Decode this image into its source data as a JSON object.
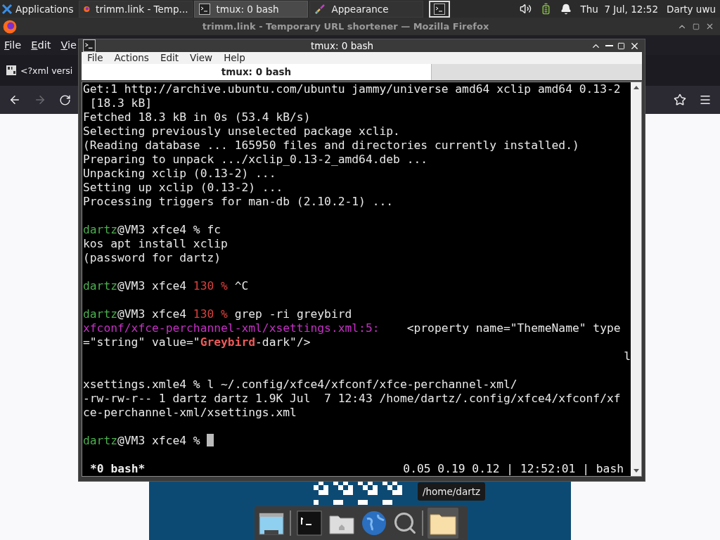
{
  "top_panel": {
    "applications": "Applications",
    "tasks": [
      {
        "kind": "firefox",
        "label": "trimm.link - Temp...",
        "selected": false
      },
      {
        "kind": "terminal",
        "label": "tmux: 0 bash",
        "selected": true
      },
      {
        "kind": "appearance",
        "label": "Appearance",
        "selected": false
      }
    ],
    "clock": "Thu  7 Jul, 12:52",
    "user": "Darty uwu"
  },
  "firefox": {
    "title": "trimm.link - Temporary URL shortener — Mozilla Firefox",
    "menu": [
      "File",
      "Edit",
      "Vie"
    ],
    "tab": "<?xml versi",
    "forward_disabled": true
  },
  "terminal": {
    "title": "tmux: 0 bash",
    "menu": [
      "File",
      "Actions",
      "Edit",
      "View",
      "Help"
    ],
    "tabs": [
      {
        "label": "tmux: 0 bash",
        "selected": true
      }
    ],
    "blocks": [
      [
        {
          "segments": [
            {
              "kind": "plain",
              "text": "Get:1 http://archive.ubuntu.com/ubuntu jammy/universe amd64 xclip amd64 0.13-2"
            }
          ]
        },
        {
          "segments": [
            {
              "kind": "plain",
              "text": " [18.3 kB]"
            }
          ]
        },
        {
          "segments": [
            {
              "kind": "plain",
              "text": "Fetched 18.3 kB in 0s (53.4 kB/s)"
            }
          ]
        },
        {
          "segments": [
            {
              "kind": "plain",
              "text": "Selecting previously unselected package xclip."
            }
          ]
        },
        {
          "segments": [
            {
              "kind": "plain",
              "text": "(Reading database ... 165950 files and directories currently installed.)"
            }
          ]
        },
        {
          "segments": [
            {
              "kind": "plain",
              "text": "Preparing to unpack .../xclip_0.13-2_amd64.deb ..."
            }
          ]
        },
        {
          "segments": [
            {
              "kind": "plain",
              "text": "Unpacking xclip (0.13-2) ..."
            }
          ]
        },
        {
          "segments": [
            {
              "kind": "plain",
              "text": "Setting up xclip (0.13-2) ..."
            }
          ]
        },
        {
          "segments": [
            {
              "kind": "plain",
              "text": "Processing triggers for man-db (2.10.2-1) ..."
            }
          ]
        }
      ],
      [
        {
          "segments": [
            {
              "kind": "user",
              "text": "dartz"
            },
            {
              "kind": "plain",
              "text": "@VM3 xfce4 % fc"
            }
          ]
        },
        {
          "segments": [
            {
              "kind": "plain",
              "text": "kos apt install xclip"
            }
          ]
        },
        {
          "segments": [
            {
              "kind": "plain",
              "text": "(password for dartz)"
            }
          ]
        }
      ],
      [
        {
          "segments": [
            {
              "kind": "user",
              "text": "dartz"
            },
            {
              "kind": "plain",
              "text": "@VM3 xfce4 "
            },
            {
              "kind": "error",
              "text": "130 %"
            },
            {
              "kind": "plain",
              "text": " ^C"
            }
          ]
        }
      ],
      [
        {
          "segments": [
            {
              "kind": "user",
              "text": "dartz"
            },
            {
              "kind": "plain",
              "text": "@VM3 xfce4 "
            },
            {
              "kind": "error",
              "text": "130 %"
            },
            {
              "kind": "plain",
              "text": " grep -ri greybird"
            }
          ]
        },
        {
          "segments": [
            {
              "kind": "path",
              "text": "xfconf/xfce-perchannel-xml/xsettings.xml:5:"
            },
            {
              "kind": "plain",
              "text": "    <property name=\"ThemeName\" type"
            }
          ]
        },
        {
          "segments": [
            {
              "kind": "plain",
              "text": "=\"string\" value=\""
            },
            {
              "kind": "match",
              "text": "Greybird"
            },
            {
              "kind": "plain",
              "text": "-dark\"/>"
            }
          ]
        },
        {
          "right_aligned": true,
          "segments": [
            {
              "kind": "plain",
              "text": "l"
            }
          ]
        }
      ],
      [
        {
          "segments": [
            {
              "kind": "plain",
              "text": "xsettings.xmle4 % l ~/.config/xfce4/xfconf/xfce-perchannel-xml/"
            }
          ]
        },
        {
          "segments": [
            {
              "kind": "plain",
              "text": "-rw-rw-r-- 1 dartz dartz 1.9K Jul  7 12:43 /home/dartz/.config/xfce4/xfconf/xf"
            }
          ]
        },
        {
          "segments": [
            {
              "kind": "plain",
              "text": "ce-perchannel-xml/xsettings.xml"
            }
          ]
        }
      ],
      [
        {
          "cursor": true,
          "segments": [
            {
              "kind": "user",
              "text": "dartz"
            },
            {
              "kind": "plain",
              "text": "@VM3 xfce4 % "
            }
          ]
        }
      ]
    ],
    "status": {
      "left": "*0 bash*",
      "right": "0.05 0.19 0.12 | 12:52:01 | bash"
    }
  },
  "tooltip": "/home/dartz"
}
